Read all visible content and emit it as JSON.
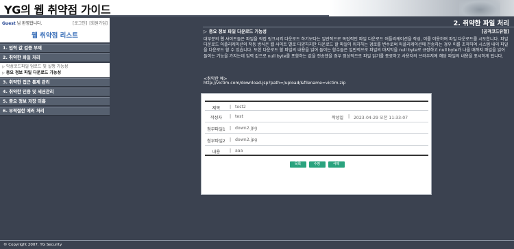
{
  "header": {
    "title": "YG의 웹 취약점 가이드"
  },
  "login": {
    "user": "Guest",
    "greeting_suffix": " 님 환영합니다.",
    "login_link": "[로그인]",
    "join_link": "[회원가입]"
  },
  "sidebar": {
    "title": "웹 취약점 리스트",
    "items": [
      {
        "label": "1. 입력 값 검증 부재"
      },
      {
        "label": "2. 취약한 파일 처리"
      },
      {
        "label": "3. 취약한 접근 통제 관리"
      },
      {
        "label": "4. 취약한 인증 및 세션관리"
      },
      {
        "label": "5. 중요 정보 저장 미흡"
      },
      {
        "label": "6. 부적절한 에러 처리"
      }
    ],
    "subitems": [
      {
        "label": "악성코드파일 업로드 및 실행 가능성"
      },
      {
        "label": "중요 정보 파일 다운로드 가능성"
      }
    ]
  },
  "main": {
    "section_title": "2. 취약한 파일 처리",
    "subheading": "중요 정보 파일 다운로드 가능성",
    "tag": "[공격코드유형]",
    "description": "대부분의 웹 사이트들은 파일을 직접 링크시켜 다운로드 하기보다는 일반적으로 독립적인 파일 다운로드 어플리케이션을 작성, 이를 이용하여 파일 다운로드를 시도합니다. 파일 다운로드 어플리케이션의 작동 방식은 웹 사이트 별로 다양하지만 다운로드 할 파일이 위치하는 경로를 변수로써 어플리케이션에 전송하는 경우 이를 조작하여 시스템 내의 파일을 다운로드 할 수 있습니다. 또한 다운로드 할 파일의 내용을 읽어 들이는 함수들은 일반적으로 파일의 마지막을 null byte로 규정하고 null byte가 나올 때까지 파일을 읽어 들이는 기능을 가지는데 입력 값으로 null byte를 포함하는 값을 전송했을 경우 정상적으로 파일 읽기를 종료하고 사용자의 브라우저에 해당 파일의 내용을 표시하게 됩니다.",
    "example_label": "<취약한 예>",
    "example_url": "http://victim.com/download.jsp?path=/upload/&filename=victim.zip"
  },
  "board": {
    "subject_label": "제목",
    "subject_value": "test2",
    "author_label": "작성자",
    "author_value": "test",
    "date_label": "작성일",
    "date_value": "2023-04-29 오전 11:33:07",
    "file1_label": "첨부파일1",
    "file1_value": "down2.jpg",
    "file2_label": "첨부파일2",
    "file2_value": "down2.jpg",
    "content_label": "내용",
    "content_value": "aaa",
    "buttons": {
      "list": "목록",
      "edit": "수정",
      "delete": "삭제"
    },
    "separator": "|"
  },
  "footer": {
    "copyright": "© Copyright 2007. YG Security"
  },
  "colors": {
    "background": "#3b4250",
    "button": "#2aa37e",
    "menu": "#56606f",
    "sidebar_title": "#3a6fb8"
  }
}
